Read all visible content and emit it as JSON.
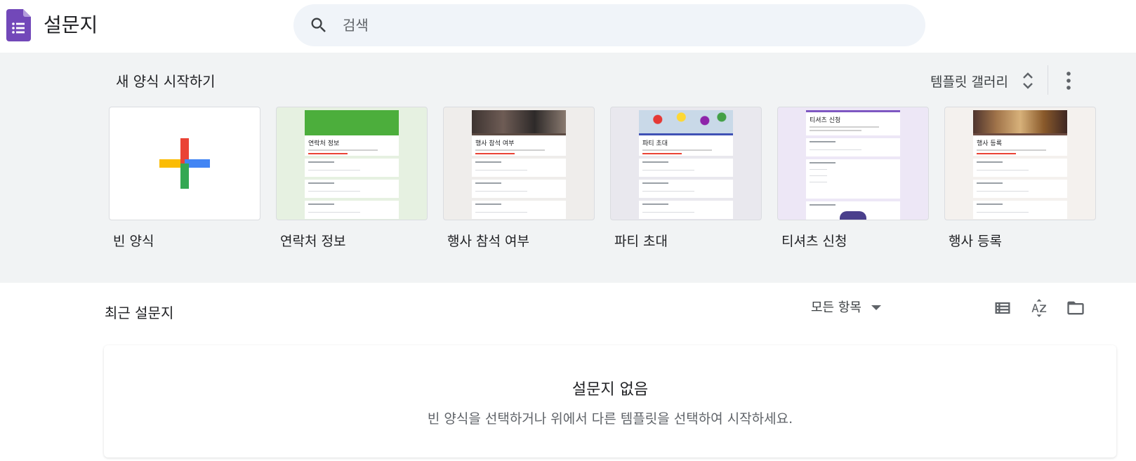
{
  "header": {
    "app_title": "설문지",
    "search_placeholder": "검색"
  },
  "templates": {
    "heading": "새 양식 시작하기",
    "gallery_label": "템플릿 갤러리",
    "cards": [
      {
        "label": "빈 양식"
      },
      {
        "label": "연락처 정보",
        "thumb_title": "연락처 정보",
        "banner_color": "#4cae3c",
        "bg": "#e6f1e1"
      },
      {
        "label": "행사 참석 여부",
        "thumb_title": "행사 참석 여부",
        "banner_color": "#5b4a42",
        "bg": "#efedeb"
      },
      {
        "label": "파티 초대",
        "thumb_title": "파티 초대",
        "banner_color": "#c9d9e8",
        "bg": "#e9e8ee"
      },
      {
        "label": "티셔츠 신청",
        "thumb_title": "티셔츠 신청",
        "banner_color": "#7e57c2",
        "bg": "#ede7f6"
      },
      {
        "label": "행사 등록",
        "thumb_title": "행사 등록",
        "banner_color": "#8a5a2b",
        "bg": "#f4f1ee"
      }
    ]
  },
  "recent": {
    "title": "최근 설문지",
    "owner_filter": "모든 항목",
    "empty_title": "설문지 없음",
    "empty_subtitle": "빈 양식을 선택하거나 위에서 다른 템플릿을 선택하여 시작하세요."
  },
  "colors": {
    "forms_purple": "#673ab7",
    "google_red": "#ea4335",
    "google_blue": "#4285f4",
    "google_yellow": "#fbbc04",
    "google_green": "#34a853"
  }
}
